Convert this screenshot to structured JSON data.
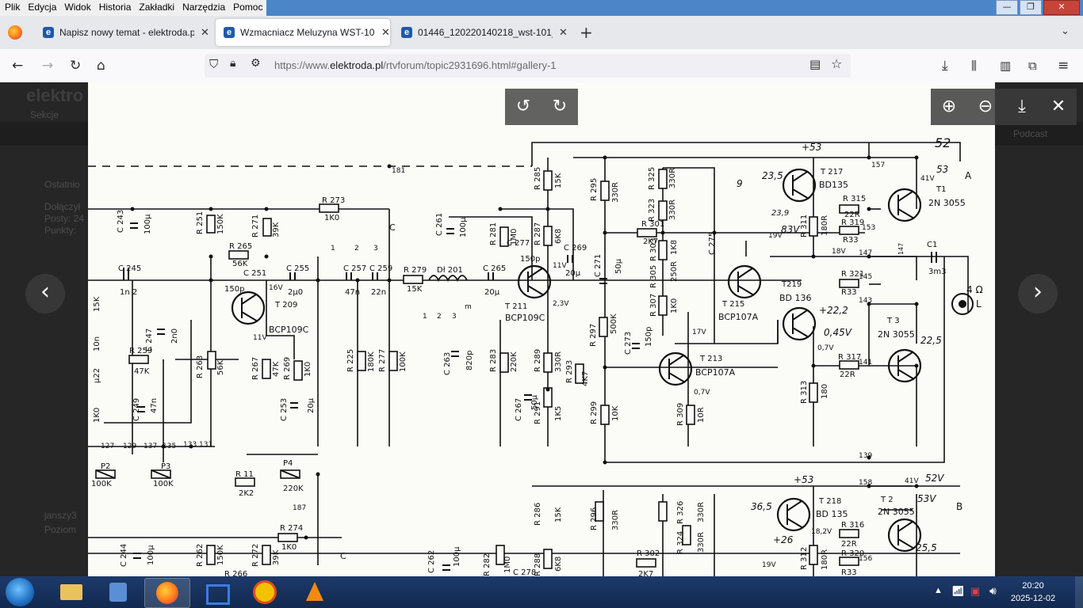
{
  "menu": [
    "Plik",
    "Edycja",
    "Widok",
    "Historia",
    "Zakładki",
    "Narzędzia",
    "Pomoc"
  ],
  "window_buttons": {
    "minimize": "—",
    "maximize": "❐",
    "close": "✕"
  },
  "tabs": [
    {
      "title": "Napisz nowy temat - elektroda.pl",
      "active": false
    },
    {
      "title": "Wzmacniacz Meluzyna WST-101",
      "active": true
    },
    {
      "title": "01446_120220140218_wst-101_b",
      "active": false
    }
  ],
  "url": {
    "prefix": "https://www.",
    "domain": "elektroda.pl",
    "path": "/rtvforum/topic2931696.html#gallery-1"
  },
  "background_site": {
    "logo": "elektro",
    "ghost_lines": [
      "Sekcje",
      "Ostatnio",
      "Dołączył",
      "Posty: 24",
      "Punkty:",
      "janszy3",
      "Poziom",
      "Podcast"
    ]
  },
  "viewer": {
    "rotate_left": "rotate-left",
    "rotate_right": "rotate-right",
    "zoom_in": "zoom-in",
    "zoom_out": "zoom-out",
    "download": "download",
    "close": "close",
    "prev": "‹",
    "next": "›"
  },
  "schematic": {
    "labels": {
      "t209": "T 209",
      "t209m": "BCP109C",
      "t211": "T 211",
      "t211m": "BCP109C",
      "t213": "T 213",
      "t213m": "BCP107A",
      "t215": "T 215",
      "t215m": "BCP107A",
      "t217": "T 217",
      "t217m": "BD135",
      "t219": "T219",
      "t219m": "BD 136",
      "t1": "T1",
      "t1m": "2N 3055",
      "t3": "T 3",
      "t3m": "2N 3055",
      "t218": "T 218",
      "t218m": "BD 135",
      "t2": "T 2",
      "t2m": "2N 3055",
      "r273": "R 273",
      "r273v": "1K0",
      "r251": "R 251",
      "r251v": "150K",
      "r271": "R 271",
      "r271v": "39K",
      "r265": "R 265",
      "r265v": "56K",
      "c251": "C 251",
      "c255": "C 255",
      "c255v": "2µ0",
      "c245": "C 245",
      "c245v": "1n 2",
      "c257": "C 257",
      "c257v": "47n",
      "c259": "C 259",
      "c259v": "22n",
      "r279": "R 279",
      "r279v": "15K",
      "dl201": "Dł 201",
      "c265": "C 265",
      "c265v": "20µ",
      "c261": "C 261",
      "c261v": "100µ",
      "r281": "R 281",
      "r281v": "1M0",
      "r285": "R 285",
      "r285v": "15K",
      "r287": "R 287",
      "r287v": "6K8",
      "c269": "C 269",
      "c269v": "20µ",
      "c277": "C 277",
      "c277v": "150p",
      "r295": "R 295",
      "r295v": "330R",
      "r301": "R 301",
      "r301v": "2K7",
      "c271": "C 271",
      "c271v": "50µ",
      "r297": "R 297",
      "r297v": "500K",
      "c273": "C 273",
      "c273v": "150p",
      "r325": "R 325",
      "r325v": "330R",
      "r323": "R 323",
      "r323v": "330R",
      "r303": "R 303",
      "r303v": "1K8",
      "r305": "R 305",
      "r305v": "250R",
      "r307": "R 307",
      "r307v": "1K0",
      "c275": "C 275",
      "r315": "R 315",
      "r315v": "22R",
      "r319": "R 319",
      "r319v": "R33",
      "r311": "R 311",
      "r311v": "180R",
      "r321": "R 321",
      "r321v": "R33",
      "r317": "R 317",
      "r317v": "22R",
      "r313": "R 313",
      "r313v": "180",
      "c1": "C1",
      "c1v": "3m3",
      "load": "4 Ω",
      "loadL": "L",
      "c263": "C 263",
      "c263v": "820p",
      "r283": "R 283",
      "r283v": "220K",
      "r289": "R 289",
      "r289v": "330R",
      "r291": "R 291",
      "r291v": "1K5",
      "r293": "R 293",
      "r293v": "4K7",
      "r299": "R 299",
      "r299v": "10K",
      "r309": "R 309",
      "r309v": "10R",
      "c267": "C 267",
      "c267v": "50µ",
      "r225": "R 225",
      "r225v": "180K",
      "r277": "R 277",
      "r277v": "100K",
      "r259": "R 259",
      "r259v": "47K",
      "c247": "C 247",
      "c247v": "2n0",
      "c249": "C 249",
      "c249v": "47n",
      "r263": "R 263",
      "r263v": "56K",
      "r267": "R 267",
      "r267v": "47K",
      "r269": "R 269",
      "r269v": "1K0",
      "c253": "C 253",
      "c253v": "20µ",
      "c243": "C 243",
      "c243v": "100µ",
      "p2": "P2",
      "p2v": "100K",
      "p3": "P3",
      "p3v": "100K",
      "p4": "P4",
      "p4v": "220K",
      "r11": "R 11",
      "r11v": "2K2",
      "r274": "R 274",
      "r274v": "1K0",
      "c244": "C 244",
      "c244v": "100µ",
      "r262": "R 262",
      "r262v": "150K",
      "r272": "R 272",
      "r272v": "39K",
      "r266": "R 266",
      "r286": "R 286",
      "r286v": "15K",
      "r296": "R 296",
      "r296v": "330R",
      "r302": "R 302",
      "r302v": "2K7",
      "r326": "R 326",
      "r326v": "330R",
      "r324": "R 324",
      "r324v": "330R",
      "r316": "R 316",
      "r316v": "22R",
      "r320": "R 320",
      "r320v": "R33",
      "r312": "R 312",
      "r312v": "180R",
      "r288": "R 288",
      "r288v": "6K8",
      "r282": "R 282",
      "r282v": "1M0",
      "c262": "C 262",
      "c262v": "100µ",
      "c278": "C 278",
      "n181": "181",
      "n187": "187",
      "n157": "157",
      "n153": "153",
      "n147": "147",
      "n145": "145",
      "n143": "143",
      "n141": "141",
      "n139": "139",
      "n158": "158",
      "n156": "156",
      "nC": "C",
      "nC2": "C",
      "nA": "A",
      "nB": "B",
      "v16": "16V",
      "v11": "11V",
      "v11b": "11V",
      "v23": "2,3V",
      "v19": "19V",
      "v18": "18V",
      "v17": "17V",
      "v07": "0,7V",
      "v07b": "0,7V",
      "v41": "41V",
      "v41b": "41V",
      "v19b": "19V",
      "v18b": "18,2V",
      "h235": "23,5",
      "h9": "9",
      "h23": "23,9",
      "h83": "83V",
      "h22": "+22,2",
      "h045": "0,45V",
      "h225": "22,5",
      "h255": "25,5",
      "h26": "+26",
      "h36": "36,5",
      "h453": "+53",
      "h52": "52",
      "h53": "53",
      "h453b": "+53",
      "h532": "52V",
      "h533": "53V",
      "sw1": "1",
      "sw2": "2",
      "sw3": "3",
      "swm": "m",
      "sw1b": "1",
      "sw2b": "2",
      "sw3b": "3",
      "n127": "127",
      "n129": "129",
      "n135": "135",
      "n137": "137",
      "n133": "133",
      "n131": "131",
      "l15k": "15K",
      "l10n": "10n",
      "l1k0": "1K0",
      "lp22": "µ22"
    }
  },
  "taskbar": {
    "apps": [
      "file-explorer",
      "media-player",
      "firefox",
      "network-app",
      "weather-app",
      "vlc"
    ],
    "time": "20:20",
    "date": "2025-12-02"
  }
}
